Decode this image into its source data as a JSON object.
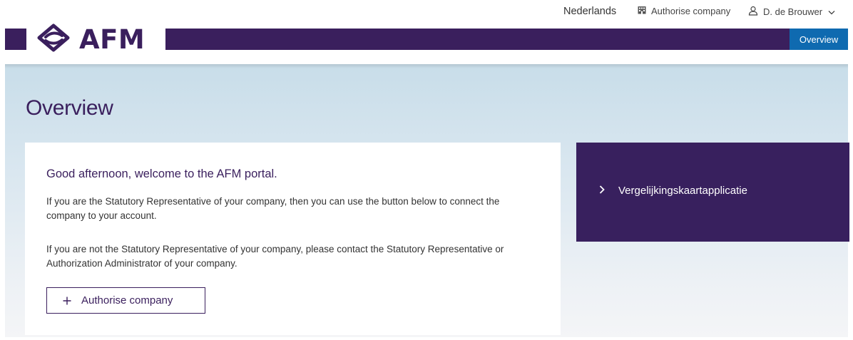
{
  "utility_bar": {
    "language_label": "Nederlands",
    "authorise_label": "Authorise company",
    "user_label": "D. de Brouwer"
  },
  "header": {
    "logo_text": "AFM",
    "nav_overview_label": "Overview"
  },
  "page": {
    "title": "Overview"
  },
  "welcome": {
    "heading": "Good afternoon, welcome to the AFM portal.",
    "paragraph_1": "If you are the Statutory Representative of your company, then you can use the button below to connect the company to your account.",
    "paragraph_2": "If you are not the Statutory Representative of your company, please contact the Statutory Representative or Authorization Administrator of your company.",
    "button_label": "Authorise company"
  },
  "side_panel": {
    "link_label": "Vergelijkingskaartapplicatie"
  },
  "colors": {
    "brand_purple": "#3a1f5d",
    "nav_blue": "#0f6ab0"
  },
  "icons": {
    "authorise": "building-icon",
    "user": "user-icon",
    "user_menu": "chevron-down-icon",
    "logo": "afm-logo-icon",
    "button": "plus-icon",
    "side_link": "chevron-right-icon"
  }
}
